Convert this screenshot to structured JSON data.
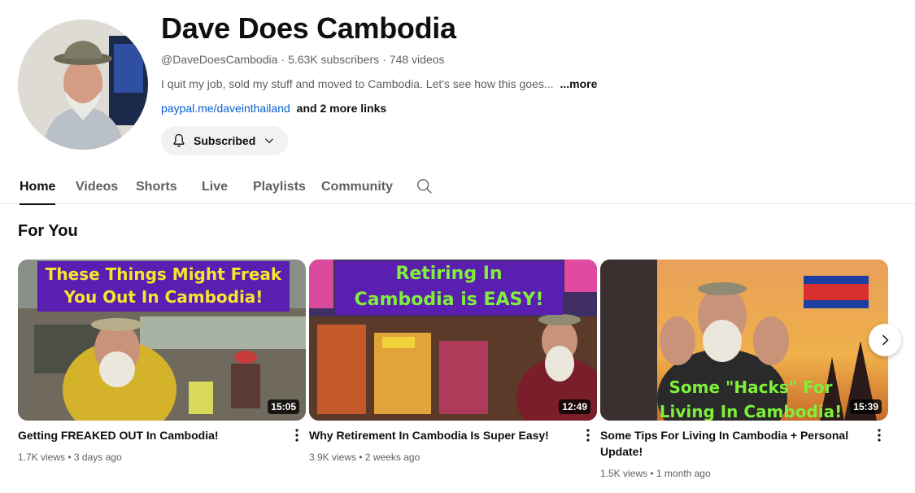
{
  "channel": {
    "name": "Dave Does Cambodia",
    "handle": "@DaveDoesCambodia",
    "subscribers": "5.63K subscribers",
    "videos": "748 videos",
    "description": "I quit my job, sold my stuff and moved to Cambodia. Let's see how this goes...",
    "more_label": "...more",
    "link": "paypal.me/daveinthailand",
    "more_links": "and 2 more links",
    "subscribe_label": "Subscribed"
  },
  "tabs": [
    {
      "label": "Home",
      "active": true
    },
    {
      "label": "Videos"
    },
    {
      "label": "Shorts"
    },
    {
      "label": "Live"
    },
    {
      "label": "Playlists"
    },
    {
      "label": "Community"
    }
  ],
  "section": {
    "title": "For You"
  },
  "videos": [
    {
      "title": "Getting FREAKED OUT In Cambodia!",
      "views": "1.7K views",
      "age": "3 days ago",
      "duration": "15:05",
      "thumb_text": [
        "These Things Might Freak",
        "You Out In Cambodia!"
      ]
    },
    {
      "title": "Why Retirement In Cambodia Is Super Easy!",
      "views": "3.9K views",
      "age": "2 weeks ago",
      "duration": "12:49",
      "thumb_text": [
        "Retiring In",
        "Cambodia is EASY!"
      ]
    },
    {
      "title": "Some Tips For Living In Cambodia + Personal Update!",
      "views": "1.5K views",
      "age": "1 month ago",
      "duration": "15:39",
      "thumb_text": [
        "Some \"Hacks\" For",
        "Living In Cambodia!"
      ]
    }
  ],
  "icons": {
    "bell": "bell-icon",
    "chevron": "chevron-down-icon",
    "search": "search-icon",
    "kebab": "more-vert-icon",
    "next": "chevron-right-icon"
  },
  "colors": {
    "link": "#065fd4",
    "banner_purple": "#5a1fb0",
    "caption_yellow": "#f7e62b",
    "caption_green": "#7ff03a"
  }
}
